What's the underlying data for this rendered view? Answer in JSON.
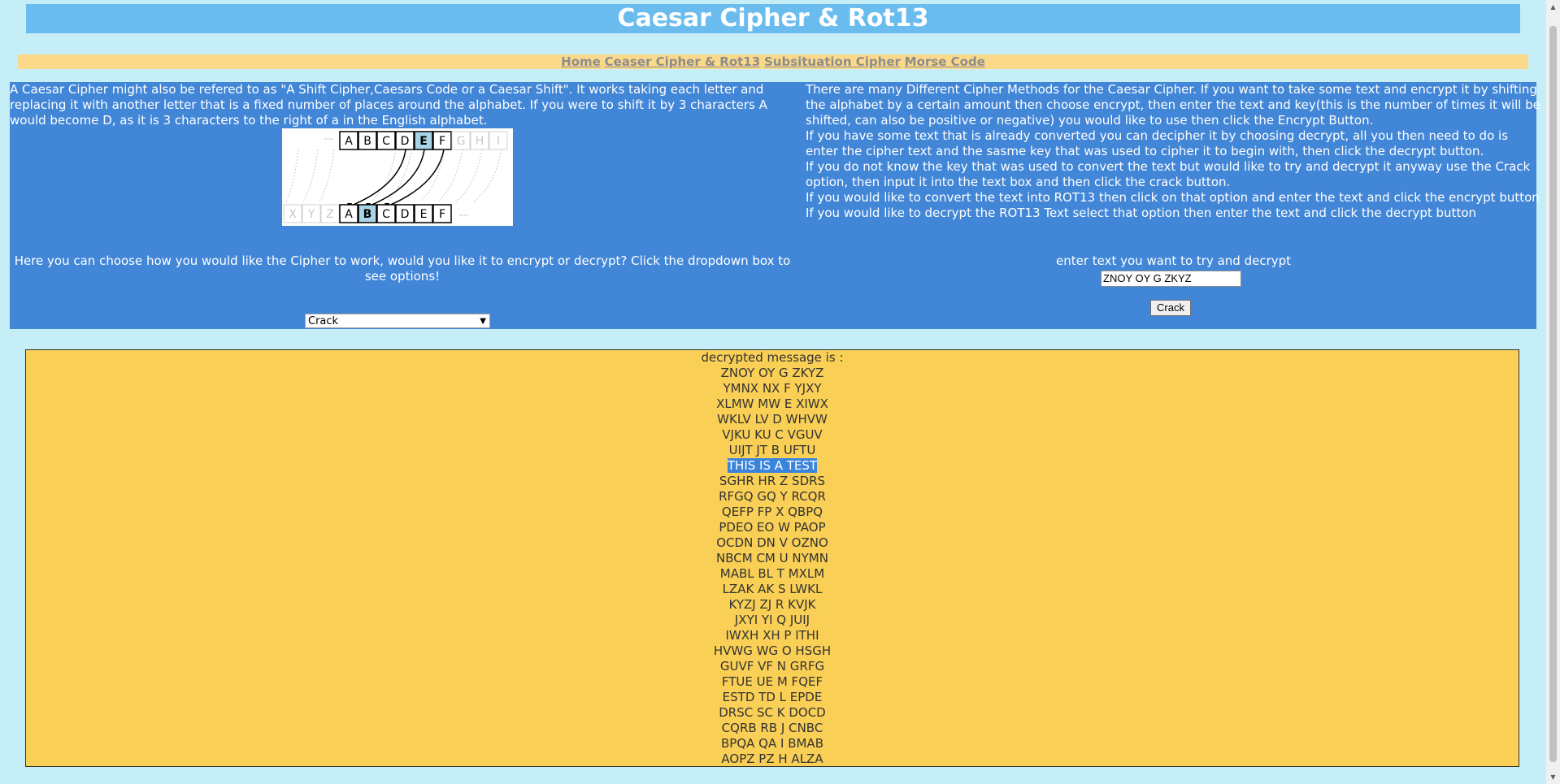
{
  "header": {
    "title": "Caesar Cipher & Rot13"
  },
  "nav": {
    "items": [
      "Home",
      "Ceaser Cipher & Rot13",
      "Subsituation Cipher",
      "Morse Code"
    ]
  },
  "left": {
    "intro": "A Caesar Cipher might also be refered to as \"A Shift Cipher,Caesars Code or a Caesar Shift\". It works taking each letter and replacing it with another letter that is a fixed number of places around the alphabet. If you were to shift it by 3 characters A would become D, as it is 3 characters to the right of a in the English alphabet.",
    "diagram": {
      "top_letters": [
        "A",
        "B",
        "C",
        "D",
        "E",
        "F"
      ],
      "top_faded": [
        "G",
        "H",
        "I"
      ],
      "bottom_faded": [
        "X",
        "Y",
        "Z"
      ],
      "bottom_letters": [
        "A",
        "B",
        "C",
        "D",
        "E",
        "F"
      ]
    },
    "choose_text": "Here you can choose how you would like the Cipher to work, would you like it to encrypt or decrypt? Click the dropdown box to see options!",
    "select_value": "Crack"
  },
  "right": {
    "paragraphs": [
      "There are many Different Cipher Methods for the Caesar Cipher. If you want to take some text and encrypt it by shifting the alphabet by a certain amount then choose encrypt, then enter the text and key(this is the number of times it will be shifted, can also be positive or negative) you would like to use then click the Encrypt Button.",
      "If you have some text that is already converted you can decipher it by choosing decrypt, all you then need to do is enter the cipher text and the sasme key that was used to cipher it to begin with, then click the decrypt button.",
      "If you do not know the key that was used to convert the text but would like to try and decrypt it anyway use the Crack option, then input it into the text box and then click the crack button.",
      "If you would like to convert the text into ROT13 then click on that option and enter the text and click the encrypt button",
      "If you would like to decrypt the ROT13 Text select that option then enter the text and click the decrypt button"
    ],
    "input_label": "enter text you want to try and decrypt",
    "input_value": "ZNOY OY G ZKYZ",
    "crack_button": "Crack"
  },
  "result": {
    "heading": "decrypted message is :",
    "lines": [
      "ZNOY OY G ZKYZ",
      "YMNX NX F YJXY",
      "XLMW MW E XIWX",
      "WKLV LV D WHVW",
      "VJKU KU C VGUV",
      "UIJT JT B UFTU",
      "THIS IS A TEST",
      "SGHR HR Z SDRS",
      "RFGQ GQ Y RCQR",
      "QEFP FP X QBPQ",
      "PDEO EO W PAOP",
      "OCDN DN V OZNO",
      "NBCM CM U NYMN",
      "MABL BL T MXLM",
      "LZAK AK S LWKL",
      "KYZJ ZJ R KVJK",
      "JXYI YI Q JUIJ",
      "IWXH XH P ITHI",
      "HVWG WG O HSGH",
      "GUVF VF N GRFG",
      "FTUE UE M FQEF",
      "ESTD TD L EPDE",
      "DRSC SC K DOCD",
      "CQRB RB J CNBC",
      "BPQA QA I BMAB",
      "AOPZ PZ H ALZA"
    ],
    "highlighted_index": 6
  },
  "colors": {
    "background": "#c5eef6",
    "header": "#6bbcee",
    "nav": "#fbd98a",
    "panel": "#4286d7",
    "result": "#f9cf55",
    "highlight": "#3b84dc"
  }
}
